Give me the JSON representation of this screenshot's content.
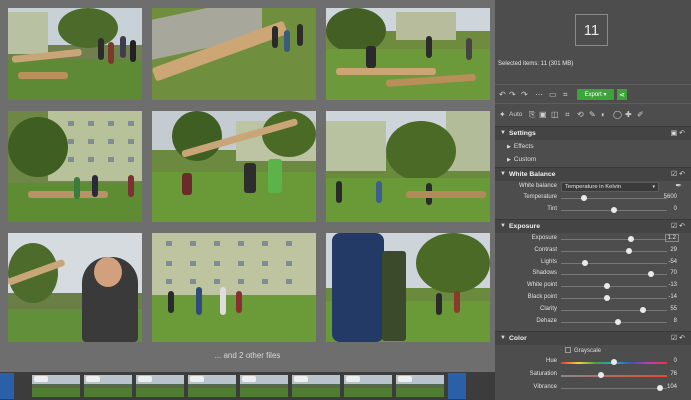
{
  "grid": {
    "more_files_label": "... and 2 other files"
  },
  "panel": {
    "count": "11",
    "selected_items": "Selected items: 11 (301 MB)",
    "toolbar": {
      "auto_label": "Auto",
      "export_label": "Export"
    },
    "settings": {
      "title": "Settings",
      "effects_label": "Effects",
      "custom_label": "Custom"
    },
    "white_balance": {
      "title": "White Balance",
      "mode_label": "White balance",
      "mode_value": "Temperature in Kelvin",
      "rows": [
        {
          "label": "Temperature",
          "value": "5600",
          "pos": 0.22
        },
        {
          "label": "Tint",
          "value": "0",
          "pos": 0.5
        }
      ]
    },
    "exposure": {
      "title": "Exposure",
      "rows": [
        {
          "label": "Exposure",
          "value": "1.2",
          "pos": 0.66,
          "boxed": true
        },
        {
          "label": "Contrast",
          "value": "29",
          "pos": 0.64
        },
        {
          "label": "Lights",
          "value": "-54",
          "pos": 0.23
        },
        {
          "label": "Shadows",
          "value": "70",
          "pos": 0.85
        },
        {
          "label": "White point",
          "value": "-13",
          "pos": 0.43
        },
        {
          "label": "Black point",
          "value": "-14",
          "pos": 0.43
        },
        {
          "label": "Clarity",
          "value": "55",
          "pos": 0.77
        },
        {
          "label": "Dehaze",
          "value": "8",
          "pos": 0.54
        }
      ]
    },
    "color": {
      "title": "Color",
      "grayscale_label": "Grayscale",
      "rows": [
        {
          "label": "Hue",
          "value": "0",
          "pos": 0.5
        },
        {
          "label": "Saturation",
          "value": "76",
          "pos": 0.38
        },
        {
          "label": "Vibrance",
          "value": "104",
          "pos": 0.93
        }
      ]
    }
  },
  "colors": {
    "accent_green": "#3fa33b",
    "panel_bg": "#4d4d4d",
    "grid_bg": "#6e6e6e"
  }
}
